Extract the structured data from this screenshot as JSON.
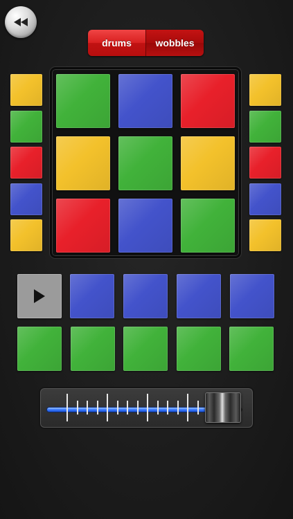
{
  "transport": {
    "back_icon": "rewind-icon",
    "play_icon": "play-icon"
  },
  "mode_switch": {
    "options": [
      "drums",
      "wobbles"
    ],
    "selected": "wobbles",
    "color": "#d82020"
  },
  "colors": {
    "yellow": "#f3c12b",
    "green": "#41b23a",
    "red": "#e8202a",
    "blue": "#4353cb",
    "slider_accent": "#3a7bff"
  },
  "left_column": [
    "yellow",
    "green",
    "red",
    "blue",
    "yellow"
  ],
  "right_column": [
    "yellow",
    "green",
    "red",
    "blue",
    "yellow"
  ],
  "main_grid": [
    [
      "green",
      "blue",
      "red"
    ],
    [
      "yellow",
      "green",
      "yellow"
    ],
    [
      "red",
      "blue",
      "green"
    ]
  ],
  "pad_row_1": [
    "blue",
    "blue",
    "blue",
    "blue"
  ],
  "pad_row_2": [
    "green",
    "green",
    "green",
    "green",
    "green"
  ],
  "slider": {
    "value_fraction": 0.85
  }
}
